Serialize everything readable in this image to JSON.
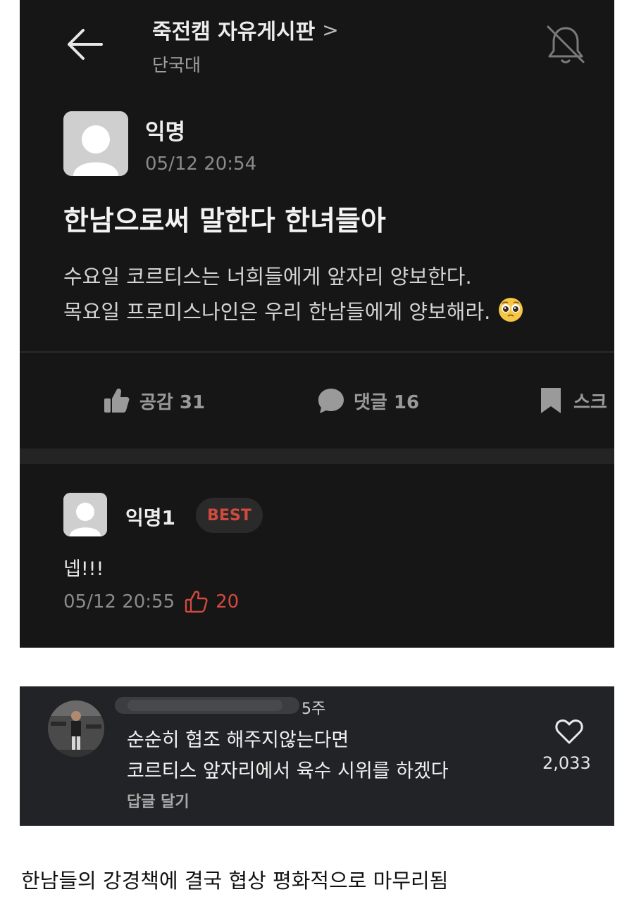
{
  "header": {
    "board_name": "죽전캠 자유게시판",
    "board_chevron": ">",
    "school": "단국대",
    "back_icon": "arrow-left-icon",
    "bell_icon": "bell-off-icon"
  },
  "post": {
    "author": "익명",
    "time": "05/12 20:54",
    "title": "한남으로써 말한다 한녀들아",
    "body_lines": [
      "수요일 코르티스는 너희들에게 앞자리 양보한다.",
      "목요일 프로미스나인은 우리 한남들에게 양보해라."
    ],
    "emoji_icon": "pleading-face-emoji"
  },
  "actions": {
    "like_label": "공감 31",
    "comment_label": "댓글 16",
    "scrap_label": "스크"
  },
  "best_comment": {
    "author": "익명1",
    "badge": "BEST",
    "text": "넵!!!",
    "time": "05/12 20:55",
    "likes": "20",
    "accent_color": "#d24a3e"
  },
  "youtube_comment": {
    "age": "5주",
    "lines": [
      "순순히 협조 해주지않는다면",
      "코르티스 앞자리에서 육수 시위를 하겠다"
    ],
    "reply_label": "답글 달기",
    "like_count": "2,033"
  },
  "caption": "한남들의 강경책에 결국 협상 평화적으로 마무리됨"
}
